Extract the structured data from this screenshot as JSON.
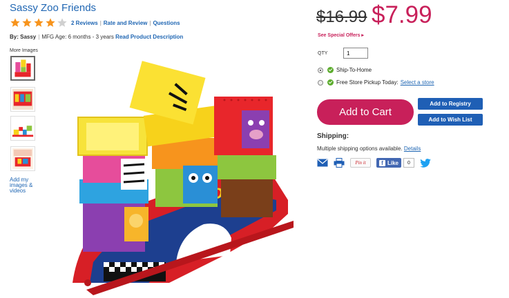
{
  "product": {
    "title": "Sassy Zoo Friends",
    "rating_stars": 4,
    "rating_max": 5,
    "reviews_link": "2 Reviews",
    "rate_link": "Rate and Review",
    "questions_link": "Questions",
    "separator": "|",
    "by_label": "By:",
    "brand": "Sassy",
    "mfg_age": "MFG Age: 6 months - 3 years",
    "read_description_link": "Read Product Description"
  },
  "gallery": {
    "more_images_label": "More Images",
    "add_images_label": "Add my images & videos"
  },
  "pricing": {
    "old_price": "$16.99",
    "new_price": "$7.99",
    "special_offers": "See Special Offers ▸"
  },
  "purchase": {
    "qty_label": "QTY",
    "qty_value": "1",
    "ship_to_home": "Ship-To-Home",
    "store_pickup": "Free Store Pickup Today:",
    "select_store_link": "Select a store",
    "add_to_cart": "Add to Cart",
    "add_to_registry": "Add to Registry",
    "add_to_wish_list": "Add to Wish List"
  },
  "shipping": {
    "title": "Shipping:",
    "text": "Multiple shipping options available.",
    "details_link": "Details"
  },
  "share": {
    "pinterest": "Pin it",
    "facebook_like": "Like",
    "facebook_f": "f",
    "like_count": "0"
  },
  "colors": {
    "title_blue": "#1f66b3",
    "price_red": "#c8205a",
    "button_blue": "#1f5fb5",
    "star_orange": "#f7941d"
  }
}
